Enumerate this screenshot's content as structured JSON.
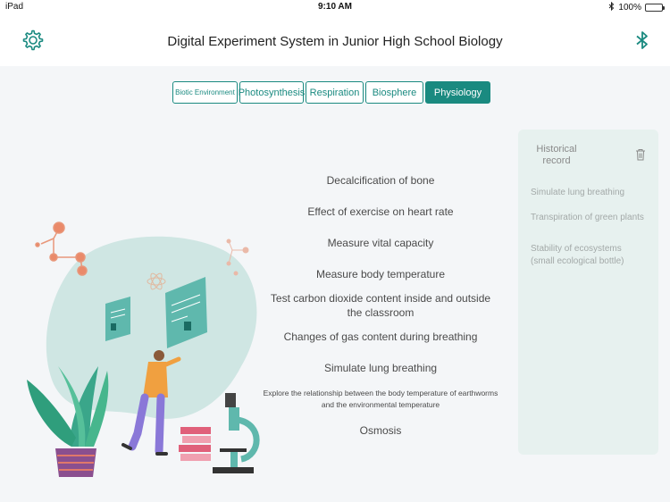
{
  "status": {
    "carrier": "iPad",
    "time": "9:10 AM",
    "battery": "100%",
    "battery_level": 1.0
  },
  "header": {
    "title": "Digital Experiment System in Junior High School Biology",
    "settings_icon": "gear-icon",
    "bluetooth_icon": "bluetooth-icon"
  },
  "tabs": [
    {
      "label": "Biotic Environment",
      "active": false
    },
    {
      "label": "Photosynthesis",
      "active": false
    },
    {
      "label": "Respiration",
      "active": false
    },
    {
      "label": "Biosphere",
      "active": false
    },
    {
      "label": "Physiology",
      "active": true
    }
  ],
  "experiments": [
    "Decalcification of bone",
    "Effect of exercise on heart rate",
    "Measure vital capacity",
    "Measure body temperature",
    "Test carbon dioxide content inside and outside the classroom",
    "Changes of gas content during breathing",
    "Simulate lung breathing",
    "Explore the relationship between the body temperature of earthworms and the environmental temperature",
    "Osmosis"
  ],
  "history": {
    "title": "Historical record",
    "delete_icon": "trash-icon",
    "items": [
      "Simulate lung breathing",
      "Transpiration of green plants",
      "Stability of ecosystems (small ecological bottle)"
    ]
  },
  "colors": {
    "accent": "#1a8a80",
    "panel": "#e7f1ef",
    "background": "#f4f6f8"
  }
}
